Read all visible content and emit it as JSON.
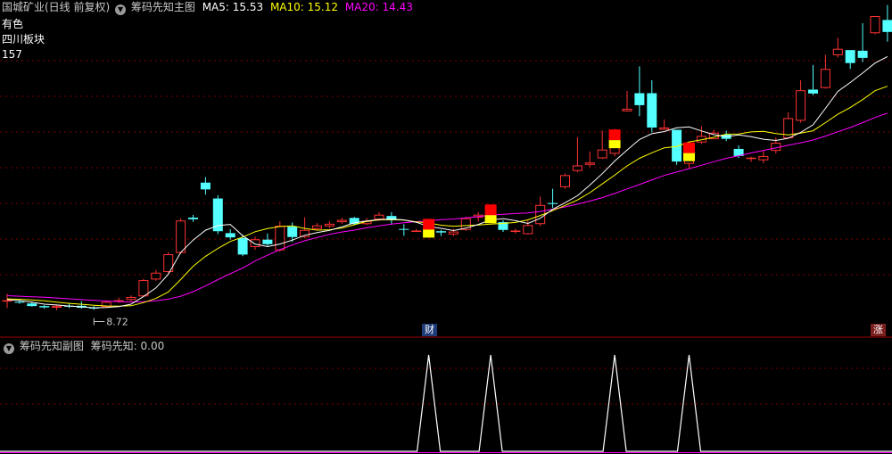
{
  "header": {
    "stock": "国城矿业(日线 前复权)",
    "indicator": "筹码先知主图",
    "ma5": "MA5: 15.53",
    "ma10": "MA10: 15.12",
    "ma20": "MA20: 14.43"
  },
  "info": {
    "industry": "有色",
    "sector": "四川板块",
    "count": "157"
  },
  "badges": {
    "cai": "财",
    "zhang": "涨"
  },
  "sub": {
    "title": "筹码先知副图",
    "value_label": "筹码先知: 0.00"
  },
  "colors": {
    "up": "#ff3232",
    "down": "#54ffff",
    "ma5": "#ffffff",
    "ma10": "#ffff00",
    "ma20": "#ff00ff",
    "signal_top": "#ff0000",
    "signal_bottom": "#ffff00"
  },
  "chart_data": [
    {
      "type": "candlestick",
      "low_label": "8.72",
      "low_index": 7,
      "signal_indices": [
        34,
        39,
        49,
        55
      ],
      "candles": [
        [
          9.28,
          9.32,
          9.72,
          8.84
        ],
        [
          9.22,
          9.18,
          9.34,
          9.1
        ],
        [
          9.12,
          8.96,
          9.24,
          8.92
        ],
        [
          8.96,
          8.88,
          9.02,
          8.8
        ],
        [
          8.86,
          8.98,
          9.04,
          8.7
        ],
        [
          8.98,
          8.92,
          9.12,
          8.84
        ],
        [
          8.98,
          8.86,
          9.26,
          8.8
        ],
        [
          8.86,
          8.82,
          8.96,
          8.72
        ],
        [
          8.9,
          9.22,
          9.3,
          8.84
        ],
        [
          9.22,
          9.32,
          9.48,
          9.16
        ],
        [
          9.34,
          9.52,
          9.62,
          9.26
        ],
        [
          9.56,
          10.56,
          10.64,
          9.52
        ],
        [
          10.6,
          11.02,
          11.2,
          10.52
        ],
        [
          11.06,
          12.16,
          12.28,
          10.98
        ],
        [
          12.24,
          14.24,
          14.38,
          12.18
        ],
        [
          14.42,
          14.32,
          14.58,
          14.16
        ],
        [
          16.58,
          16.16,
          16.92,
          15.84
        ],
        [
          15.6,
          13.58,
          15.8,
          13.4
        ],
        [
          13.46,
          13.2,
          13.7,
          13.06
        ],
        [
          13.16,
          12.14,
          13.36,
          12.04
        ],
        [
          12.6,
          13.08,
          13.24,
          12.44
        ],
        [
          13.06,
          12.78,
          13.44,
          12.66
        ],
        [
          12.4,
          13.92,
          14.2,
          12.32
        ],
        [
          13.86,
          13.22,
          14.12,
          12.92
        ],
        [
          13.22,
          13.66,
          14.44,
          13.16
        ],
        [
          13.72,
          13.94,
          14.08,
          13.68
        ],
        [
          13.88,
          14.04,
          14.2,
          13.78
        ],
        [
          14.14,
          14.28,
          14.42,
          14.04
        ],
        [
          14.4,
          14.02,
          14.46,
          13.94
        ],
        [
          14.02,
          14.22,
          14.4,
          13.96
        ],
        [
          14.3,
          14.6,
          14.76,
          14.22
        ],
        [
          14.52,
          14.26,
          14.76,
          14.04
        ],
        [
          13.72,
          13.68,
          14.02,
          13.3
        ],
        [
          13.56,
          13.62,
          13.72,
          13.54
        ],
        [
          13.58,
          13.56,
          13.96,
          13.4
        ],
        [
          13.58,
          13.5,
          13.66,
          13.28
        ],
        [
          13.38,
          13.56,
          13.72,
          13.28
        ],
        [
          13.66,
          14.38,
          14.46,
          13.6
        ],
        [
          14.42,
          14.6,
          14.76,
          14.18
        ],
        [
          14.46,
          14.46,
          14.54,
          14.4
        ],
        [
          14.14,
          13.66,
          14.26,
          13.54
        ],
        [
          13.54,
          13.62,
          13.74,
          13.44
        ],
        [
          13.4,
          13.96,
          14.24,
          13.38
        ],
        [
          14.02,
          15.2,
          15.72,
          13.88
        ],
        [
          15.32,
          15.26,
          16.2,
          15.02
        ],
        [
          16.3,
          17.04,
          17.14,
          16.2
        ],
        [
          17.3,
          17.64,
          19.38,
          17.22
        ],
        [
          17.68,
          17.82,
          18.5,
          17.54
        ],
        [
          18.08,
          18.62,
          19.8,
          18.04
        ],
        [
          18.36,
          19.82,
          19.9,
          18.2
        ],
        [
          20.98,
          21.14,
          22.24,
          20.96
        ],
        [
          22.1,
          21.36,
          23.76,
          20.68
        ],
        [
          22.1,
          19.98,
          22.9,
          19.68
        ],
        [
          19.84,
          19.98,
          20.48,
          19.84
        ],
        [
          19.84,
          17.88,
          19.8,
          17.68
        ],
        [
          17.74,
          18.84,
          18.88,
          17.44
        ],
        [
          19.06,
          19.46,
          20.08,
          18.96
        ],
        [
          19.26,
          19.66,
          19.84,
          19.46
        ],
        [
          19.54,
          19.28,
          19.78,
          19.14
        ],
        [
          18.66,
          18.22,
          18.88,
          18.1
        ],
        [
          18.1,
          18.12,
          18.18,
          17.86
        ],
        [
          17.96,
          18.22,
          18.54,
          17.78
        ],
        [
          18.54,
          19.04,
          19.36,
          18.38
        ],
        [
          19.32,
          20.56,
          20.92,
          19.3
        ],
        [
          20.4,
          22.28,
          22.9,
          20.28
        ],
        [
          22.32,
          22.08,
          23.84,
          21.98
        ],
        [
          22.42,
          23.6,
          24.46,
          22.38
        ],
        [
          24.44,
          24.84,
          25.52,
          24.3
        ],
        [
          24.76,
          23.96,
          24.74,
          23.6
        ],
        [
          24.72,
          24.28,
          26.42,
          24.02
        ],
        [
          25.8,
          26.86,
          26.82,
          25.74
        ],
        [
          26.62,
          25.88,
          27.54,
          25.28
        ]
      ],
      "ma5": [
        9.36,
        9.3,
        9.2,
        9.08,
        9.03,
        8.96,
        8.91,
        8.85,
        8.87,
        8.93,
        9.08,
        9.55,
        10.08,
        10.92,
        12.27,
        13.03,
        13.64,
        13.93,
        14.0,
        13.3,
        12.79,
        12.63,
        12.79,
        13.03,
        13.33,
        13.5,
        13.63,
        13.85,
        14.1,
        14.21,
        14.3,
        14.33,
        14.28,
        14.13,
        13.87,
        13.76,
        13.62,
        13.77,
        14.0,
        14.28,
        14.36,
        14.23,
        14.06,
        14.38,
        14.93,
        15.34,
        15.77,
        16.43,
        17.13,
        17.91,
        18.59,
        19.24,
        19.6,
        19.73,
        19.96,
        20.02,
        19.77,
        19.54,
        19.42,
        19.52,
        19.41,
        19.26,
        19.18,
        19.32,
        19.68,
        20.15,
        21.16,
        22.21,
        22.76,
        23.34,
        23.96,
        24.36
      ],
      "ma10": [
        9.4,
        9.38,
        9.34,
        9.28,
        9.2,
        9.13,
        9.07,
        9.01,
        8.97,
        8.95,
        8.98,
        9.17,
        9.43,
        9.83,
        10.6,
        11.42,
        12.03,
        12.52,
        12.95,
        13.22,
        13.55,
        13.74,
        13.87,
        13.91,
        13.75,
        13.65,
        13.67,
        13.78,
        13.98,
        14.18,
        14.28,
        14.3,
        14.27,
        14.16,
        14.09,
        13.95,
        13.89,
        13.93,
        13.96,
        14.02,
        14.06,
        14.12,
        14.28,
        14.55,
        14.85,
        15.17,
        15.51,
        15.96,
        16.5,
        17.04,
        17.61,
        18.08,
        18.42,
        18.73,
        18.81,
        19.09,
        19.22,
        19.38,
        19.57,
        19.58,
        19.71,
        19.75,
        19.61,
        19.53,
        19.64,
        19.78,
        20.28,
        20.8,
        21.21,
        21.7,
        22.25,
        22.53
      ],
      "ma20": [
        9.6,
        9.57,
        9.53,
        9.5,
        9.46,
        9.41,
        9.36,
        9.31,
        9.27,
        9.24,
        9.21,
        9.23,
        9.28,
        9.39,
        9.57,
        9.85,
        10.2,
        10.59,
        10.96,
        11.31,
        11.74,
        12.1,
        12.44,
        12.73,
        12.99,
        13.19,
        13.39,
        13.53,
        13.65,
        13.79,
        13.91,
        14.02,
        14.1,
        14.17,
        14.22,
        14.29,
        14.33,
        14.4,
        14.49,
        14.58,
        14.63,
        14.67,
        14.71,
        14.8,
        14.94,
        15.08,
        15.25,
        15.44,
        15.65,
        15.91,
        16.19,
        16.46,
        16.75,
        17.02,
        17.23,
        17.44,
        17.65,
        17.87,
        18.08,
        18.24,
        18.41,
        18.57,
        18.72,
        18.89,
        19.04,
        19.21,
        19.45,
        19.72,
        19.98,
        20.28,
        20.6,
        20.87
      ]
    },
    {
      "type": "line",
      "series": [
        {
          "name": "筹码先知",
          "indices": [
            34,
            39,
            49,
            55
          ],
          "value": 1
        }
      ]
    }
  ]
}
